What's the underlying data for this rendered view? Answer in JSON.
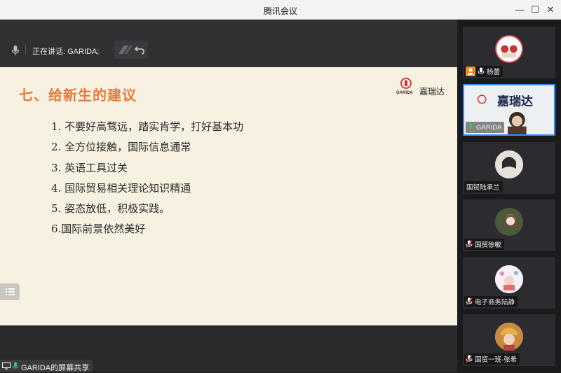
{
  "window": {
    "title": "腾讯会议",
    "controls": [
      "minimize-icon",
      "maximize-icon",
      "close-icon"
    ]
  },
  "speaking": {
    "label": "正在讲话: GARIDA;"
  },
  "slide": {
    "heading": "七、给新生的建议",
    "logo_text": "嘉瑞达",
    "logo_wordmark": "GARIDA",
    "points": [
      "1. 不要好高骛远，踏实肯学，打好基本功",
      "2. 全方位接触，国际信息通常",
      "3. 英语工具过关",
      "4. 国际贸易相关理论知识精通",
      "5. 姿态放低，积极实践。",
      "6.国际前景依然美好"
    ]
  },
  "share": {
    "label": "GARIDA的屏幕共享"
  },
  "participants": [
    {
      "name": "杨蕾",
      "mic": "on",
      "host_badge": true,
      "active": false
    },
    {
      "name": "GARIDA",
      "mic": "on",
      "host_badge": false,
      "active": true
    },
    {
      "name": "国贸陆承兰",
      "mic": "none",
      "host_badge": false,
      "active": false
    },
    {
      "name": "国贸徐敏",
      "mic": "muted",
      "host_badge": false,
      "active": false
    },
    {
      "name": "电子商务陆静",
      "mic": "muted",
      "host_badge": false,
      "active": false
    },
    {
      "name": "国贸一班-张希",
      "mic": "muted",
      "host_badge": false,
      "active": false
    }
  ],
  "colors": {
    "accent": "#2f8fff",
    "heading": "#e67b3a",
    "host_badge": "#f08a24",
    "mic_on": "#3bc46a",
    "mic_muted": "#e53935"
  }
}
